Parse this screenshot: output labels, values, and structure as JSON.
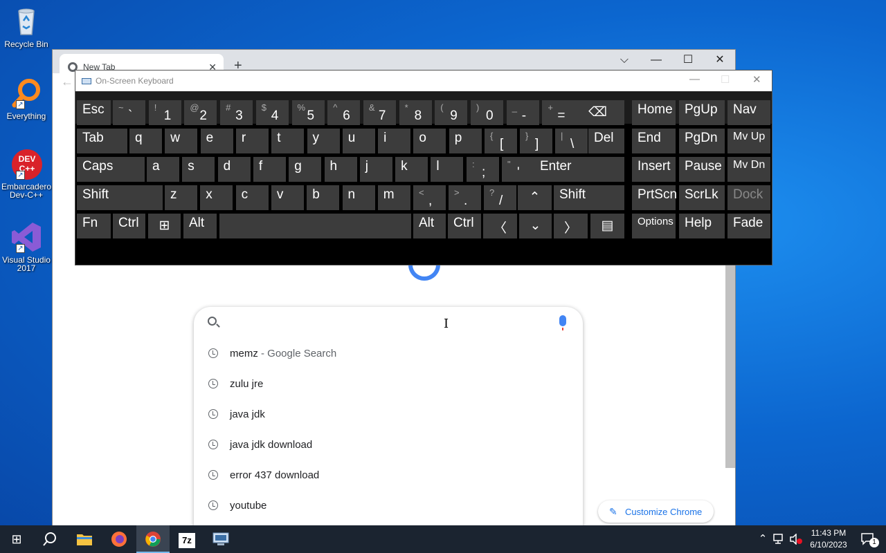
{
  "desktop": {
    "icons": [
      {
        "label": "Recycle Bin"
      },
      {
        "label": "Everything"
      },
      {
        "label_line1": "Embarcadero",
        "label_line2": "Dev-C++",
        "logo": "DEV C++"
      },
      {
        "label_line1": "Visual Studio",
        "label_line2": "2017"
      }
    ]
  },
  "chrome": {
    "tab_title": "New Tab",
    "tab_close": "✕",
    "new_tab": "+",
    "controls": {
      "dropdown": "⌵",
      "minimize": "—",
      "maximize": "☐",
      "close": "✕"
    },
    "back": "←",
    "suggestions": [
      {
        "text": "memz",
        "sub": " - Google Search"
      },
      {
        "text": "zulu jre",
        "sub": ""
      },
      {
        "text": "java jdk",
        "sub": ""
      },
      {
        "text": "java jdk download",
        "sub": ""
      },
      {
        "text": "error 437 download",
        "sub": ""
      },
      {
        "text": "youtube",
        "sub": ""
      }
    ],
    "customize_label": "Customize Chrome",
    "customize_icon": "✎"
  },
  "osk": {
    "title": "On-Screen Keyboard",
    "controls": {
      "minimize": "—",
      "maximize": "☐",
      "close": "✕"
    },
    "row1": {
      "esc": "Esc",
      "keys": [
        {
          "s": "~",
          "m": "`"
        },
        {
          "s": "!",
          "m": "1"
        },
        {
          "s": "@",
          "m": "2"
        },
        {
          "s": "#",
          "m": "3"
        },
        {
          "s": "$",
          "m": "4"
        },
        {
          "s": "%",
          "m": "5"
        },
        {
          "s": "^",
          "m": "6"
        },
        {
          "s": "&",
          "m": "7"
        },
        {
          "s": "*",
          "m": "8"
        },
        {
          "s": "(",
          "m": "9"
        },
        {
          "s": ")",
          "m": "0"
        },
        {
          "s": "_",
          "m": "-"
        },
        {
          "s": "+",
          "m": "="
        }
      ],
      "backspace": "⌫",
      "home": "Home",
      "pgup": "PgUp",
      "nav": "Nav"
    },
    "row2": {
      "tab": "Tab",
      "letters": [
        "q",
        "w",
        "e",
        "r",
        "t",
        "y",
        "u",
        "i",
        "o",
        "p"
      ],
      "brackets": [
        {
          "s": "{",
          "m": "["
        },
        {
          "s": "}",
          "m": "]"
        },
        {
          "s": "|",
          "m": "\\"
        }
      ],
      "del": "Del",
      "end": "End",
      "pgdn": "PgDn",
      "mvup": "Mv Up"
    },
    "row3": {
      "caps": "Caps",
      "letters": [
        "a",
        "s",
        "d",
        "f",
        "g",
        "h",
        "j",
        "k",
        "l"
      ],
      "punct": [
        {
          "s": ":",
          "m": ";"
        },
        {
          "s": "\"",
          "m": "'"
        }
      ],
      "enter": "Enter",
      "insert": "Insert",
      "pause": "Pause",
      "mvdn": "Mv Dn"
    },
    "row4": {
      "shift_l": "Shift",
      "letters": [
        "z",
        "x",
        "c",
        "v",
        "b",
        "n",
        "m"
      ],
      "punct": [
        {
          "s": "<",
          "m": ","
        },
        {
          "s": ">",
          "m": "."
        },
        {
          "s": "?",
          "m": "/"
        }
      ],
      "up": "⌃",
      "shift_r": "Shift",
      "prtscn": "PrtScn",
      "scrlk": "ScrLk",
      "dock": "Dock"
    },
    "row5": {
      "fn": "Fn",
      "ctrl_l": "Ctrl",
      "win": "⊞",
      "alt_l": "Alt",
      "space": "",
      "alt_r": "Alt",
      "ctrl_r": "Ctrl",
      "left": "〈",
      "down": "⌄",
      "right": "〉",
      "menu": "▤",
      "options": "Options",
      "help": "Help",
      "fade": "Fade"
    }
  },
  "taskbar": {
    "start": "⊞",
    "search": "⚲",
    "apps": [
      "file-explorer",
      "firefox",
      "chrome",
      "7zip",
      "on-screen-keyboard"
    ],
    "sevenzip_label": "7z",
    "tray_up": "⌃",
    "time": "11:43 PM",
    "date": "6/10/2023",
    "notification_count": "1"
  }
}
